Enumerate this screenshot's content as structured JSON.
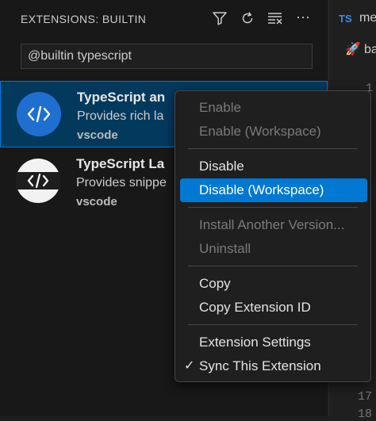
{
  "sidebar": {
    "title": "EXTENSIONS: BUILTIN",
    "actions": [
      "filter-icon",
      "refresh-icon",
      "clear-icon",
      "more-icon"
    ],
    "more_label": "···",
    "search": {
      "value": "@builtin typescript"
    }
  },
  "extensions": [
    {
      "name": "TypeScript an",
      "description": "Provides rich la",
      "publisher": "vscode",
      "icon": "code-brackets-icon",
      "selected": true
    },
    {
      "name": "TypeScript La",
      "description": "Provides snippe",
      "publisher": "vscode",
      "icon": "code-brackets-icon",
      "selected": false
    }
  ],
  "editor": {
    "tab": {
      "badge": "TS",
      "name": "me"
    },
    "breadcrumb": {
      "icon": "rocket-icon",
      "text": "ba"
    },
    "line_numbers": [
      "1",
      "17",
      "18"
    ]
  },
  "context_menu": {
    "items": [
      {
        "label": "Enable",
        "disabled": true
      },
      {
        "label": "Enable (Workspace)",
        "disabled": true
      },
      {
        "label": "Disable",
        "disabled": false
      },
      {
        "label": "Disable (Workspace)",
        "disabled": false,
        "highlighted": true
      },
      {
        "label": "Install Another Version...",
        "disabled": true
      },
      {
        "label": "Uninstall",
        "disabled": true
      },
      {
        "label": "Copy",
        "disabled": false
      },
      {
        "label": "Copy Extension ID",
        "disabled": false
      },
      {
        "label": "Extension Settings",
        "disabled": false
      },
      {
        "label": "Sync This Extension",
        "disabled": false,
        "checked": true
      }
    ],
    "check_mark": "✓"
  },
  "colors": {
    "accent": "#0078d4",
    "selection_bg": "#04395e",
    "ts_badge": "#3b8eea"
  }
}
